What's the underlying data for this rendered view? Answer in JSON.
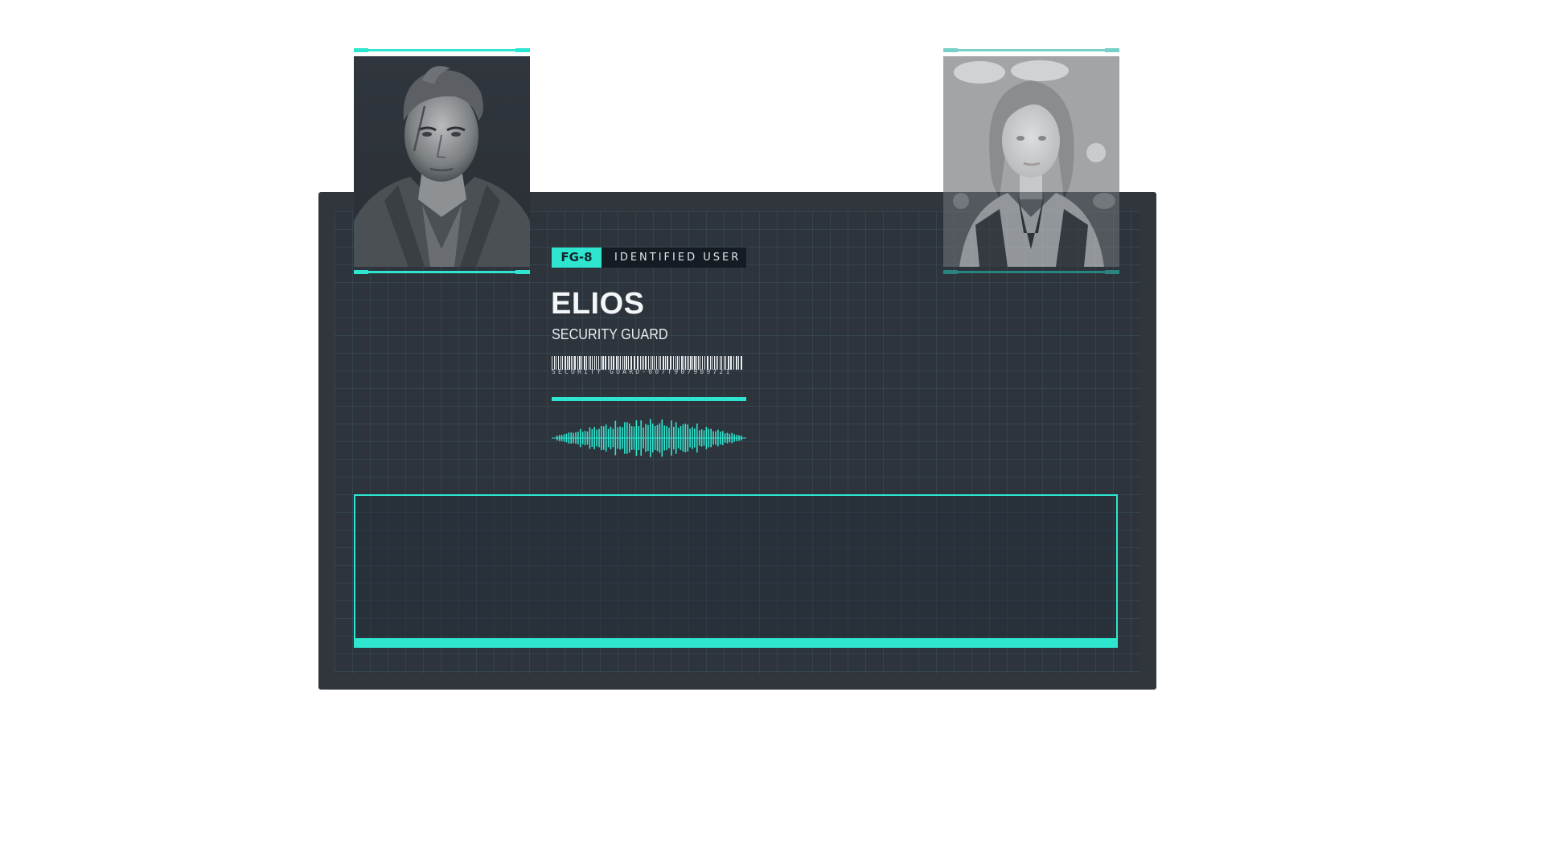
{
  "badge": {
    "code": "FG-8",
    "label": "IDENTIFIED USER"
  },
  "profile": {
    "name": "ELIOS",
    "role": "SECURITY GUARD",
    "serial": "SECURITY GUARD-007T907989721"
  },
  "photos": {
    "primary": "male-character-portrait",
    "secondary": "female-character-portrait"
  },
  "colors": {
    "accent": "#2ee6d0",
    "card_background": "#31363d",
    "badge_dark": "#141b22"
  }
}
